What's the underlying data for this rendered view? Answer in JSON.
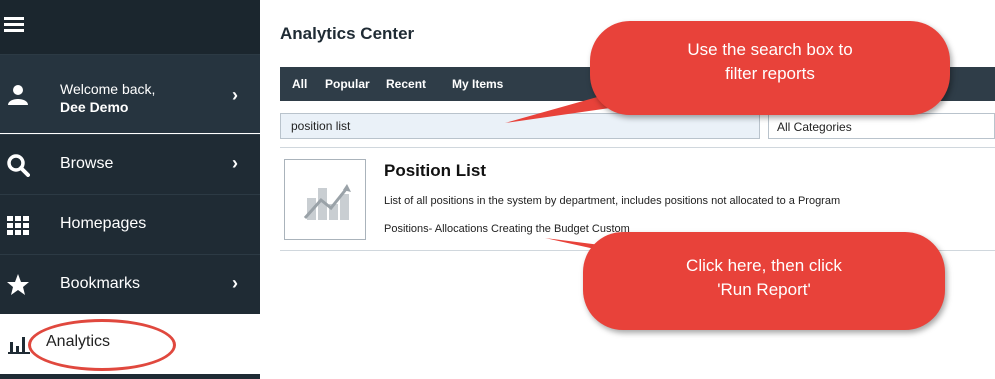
{
  "sidebar": {
    "welcome_line1": "Welcome back,",
    "welcome_line2": "Dee Demo",
    "items": [
      {
        "label": "Browse",
        "icon": "search-icon"
      },
      {
        "label": "Homepages",
        "icon": "grid-icon"
      },
      {
        "label": "Bookmarks",
        "icon": "star-icon"
      }
    ],
    "analytics_label": "Analytics"
  },
  "main": {
    "title": "Analytics Center",
    "tabs": [
      "All",
      "Popular",
      "Recent",
      "My Items"
    ],
    "search_value": "position list",
    "category_select": "All Categories",
    "result": {
      "title": "Position List",
      "description": "List of all positions in the system by department, includes positions not allocated to a Program",
      "tags": "Positions- Allocations Creating the Budget  Custom"
    }
  },
  "callouts": {
    "search_tip_line1": "Use the search box to",
    "search_tip_line2": "filter reports",
    "click_tip_line1": "Click here, then click",
    "click_tip_line2": "'Run Report'"
  },
  "colors": {
    "sidebar_bg": "#1f2b34",
    "callout_red": "#e8423a",
    "circle_red": "#e0483e"
  }
}
